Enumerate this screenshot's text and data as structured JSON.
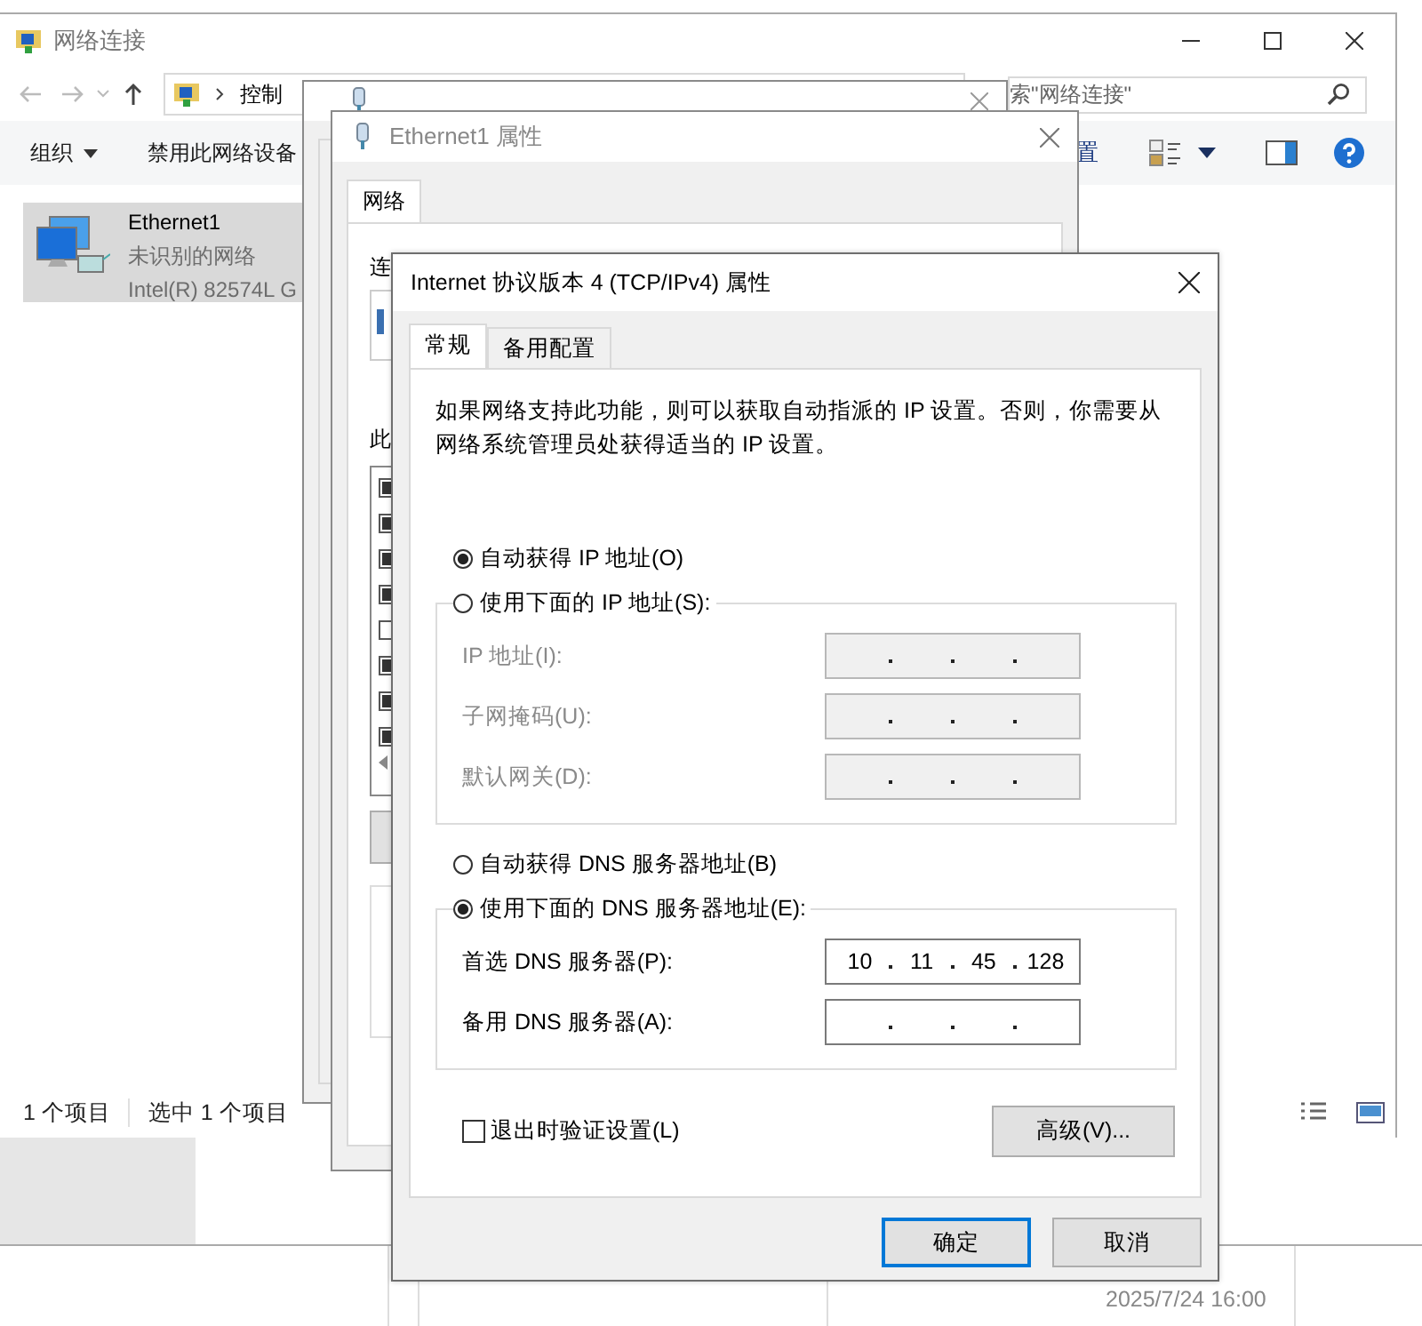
{
  "explorer": {
    "title": "网络连接",
    "address": {
      "segment": "控制"
    },
    "search": {
      "placeholder": "索\"网络连接\""
    },
    "toolbar": [
      {
        "label": "组织",
        "kind": "menu"
      },
      {
        "label": "禁用此网络设备",
        "kind": "command"
      }
    ],
    "toolbar_right": {
      "label": "置"
    },
    "items": [
      {
        "name": "Ethernet1",
        "status": "未识别的网络",
        "device": "Intel(R) 82574L G",
        "selected": true
      }
    ],
    "status_bar": {
      "count": "1 个项目",
      "selection": "选中 1 个项目"
    }
  },
  "properties": {
    "title": "Ethernet1 属性",
    "tabs": [
      {
        "label": "网络",
        "selected": true
      }
    ],
    "connect_label": "连",
    "components_label": "此",
    "components": [
      {
        "checked": true
      },
      {
        "checked": true
      },
      {
        "checked": true
      },
      {
        "checked": true
      },
      {
        "checked": false
      },
      {
        "checked": true
      },
      {
        "checked": true
      },
      {
        "checked": true
      }
    ]
  },
  "dialog": {
    "title": "Internet 协议版本 4 (TCP/IPv4) 属性",
    "tabs": [
      {
        "label": "常规",
        "selected": true
      },
      {
        "label": "备用配置",
        "selected": false
      }
    ],
    "intro": "如果网络支持此功能，则可以获取自动指派的 IP 设置。否则，你需要从网络系统管理员处获得适当的 IP 设置。",
    "ip_mode": [
      {
        "label": "自动获得 IP 地址(O)",
        "selected": true
      },
      {
        "label": "使用下面的 IP 地址(S):",
        "selected": false
      }
    ],
    "ip_fields": [
      {
        "label": "IP 地址(I):",
        "disabled": true
      },
      {
        "label": "子网掩码(U):",
        "disabled": true
      },
      {
        "label": "默认网关(D):",
        "disabled": true
      }
    ],
    "dns_mode": [
      {
        "label": "自动获得 DNS 服务器地址(B)",
        "selected": false
      },
      {
        "label": "使用下面的 DNS 服务器地址(E):",
        "selected": true
      }
    ],
    "dns_fields": [
      {
        "label": "首选 DNS 服务器(P):",
        "disabled": false,
        "octets": [
          "10",
          "11",
          "45",
          "128"
        ]
      },
      {
        "label": "备用 DNS 服务器(A):",
        "disabled": false
      }
    ],
    "validate": {
      "label": "退出时验证设置(L)",
      "checked": false
    },
    "advanced": "高级(V)...",
    "buttons": [
      {
        "label": "确定",
        "kind": "default"
      },
      {
        "label": "取消",
        "kind": "normal"
      }
    ]
  },
  "clock": "2025/7/24 16:00"
}
